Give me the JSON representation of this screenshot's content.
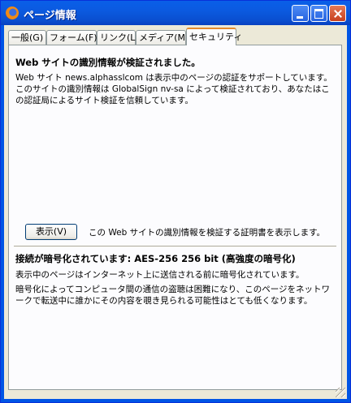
{
  "window": {
    "title": "ページ情報"
  },
  "tabs": [
    {
      "label": "一般(G)"
    },
    {
      "label": "フォーム(F)"
    },
    {
      "label": "リンク(L)"
    },
    {
      "label": "メディア(M)"
    },
    {
      "label": "セキュリティ"
    }
  ],
  "active_tab": "セキュリティ",
  "security": {
    "identity_heading": "Web サイトの識別情報が検証されました。",
    "identity_text": "Web サイト news.alphasslcom は表示中のページの認証をサポートしています。このサイトの識別情報は GlobalSign nv-sa によって検証されており、あなたはこの認証局によるサイト検証を信頼しています。",
    "view_button": "表示(V)",
    "view_description": "この Web サイトの識別情報を検証する証明書を表示します。",
    "encryption_heading": "接続が暗号化されています: AES-256 256 bit (高強度の暗号化)",
    "encryption_text1": "表示中のページはインターネット上に送信される前に暗号化されています。",
    "encryption_text2": "暗号化によってコンピュータ間の通信の盗聴は困難になり、このページをネットワークで転送中に誰かにその内容を覗き見られる可能性はとても低くなります。"
  },
  "colors": {
    "titlebar": "#0a5fe8",
    "tab_highlight": "#e68b2c",
    "panel_bg": "#fcfcfe",
    "dialog_bg": "#ece9d8"
  }
}
